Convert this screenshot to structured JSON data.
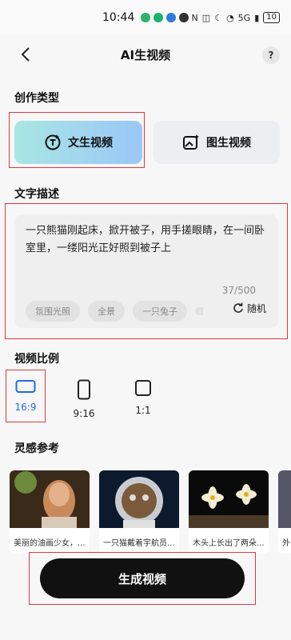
{
  "status_bar": {
    "time": "10:44",
    "battery": "10",
    "network": "5G"
  },
  "header": {
    "title": "AI生视频",
    "help": "?"
  },
  "creation_type": {
    "title": "创作类型",
    "options": [
      {
        "label": "文生视频"
      },
      {
        "label": "图生视频"
      }
    ]
  },
  "description": {
    "title": "文字描述",
    "text": "一只熊猫刚起床，掀开被子，用手搓眼睛，在一间卧室里，一缕阳光正好照到被子上",
    "count": "37/500",
    "chips": [
      "氛围光照",
      "全景",
      "一只兔子"
    ],
    "random_label": "随机"
  },
  "ratio": {
    "title": "视频比例",
    "options": [
      {
        "label": "16:9"
      },
      {
        "label": "9:16"
      },
      {
        "label": "1:1"
      }
    ]
  },
  "inspiration": {
    "title": "灵感参考",
    "cards": [
      {
        "caption": "美丽的油画少女，..."
      },
      {
        "caption": "一只猫戴着宇航员..."
      },
      {
        "caption": "木头上长出了两朵..."
      },
      {
        "caption": "外"
      }
    ]
  },
  "generate_label": "生成视频",
  "colors": {
    "accent": "#1e6be6",
    "highlight_border": "#e0383e"
  }
}
